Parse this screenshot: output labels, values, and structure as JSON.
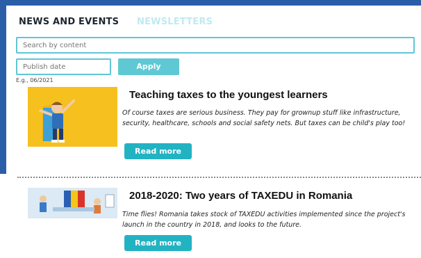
{
  "tabs": {
    "news": "NEWS AND EVENTS",
    "newsletters": "NEWSLETTERS"
  },
  "search": {
    "placeholder": "Search by content",
    "value": ""
  },
  "date_filter": {
    "placeholder": "Publish date",
    "value": "",
    "hint": "E.g., 06/2021"
  },
  "apply_label": "Apply",
  "articles": [
    {
      "title": "Teaching taxes to the youngest learners",
      "excerpt": "Of course taxes are serious business. They pay for grownup stuff like infrastructure, security, healthcare, schools and social safety nets. But taxes can be child's play too!",
      "button": "Read more"
    },
    {
      "title": "2018-2020: Two years of TAXEDU in Romania",
      "excerpt": "Time flies! Romania takes stock of TAXEDU activities implemented since the project's launch in the country in 2018, and looks to the future.",
      "button": "Read more"
    }
  ],
  "colors": {
    "frame": "#2a5fa8",
    "accent": "#5fc6d6",
    "button": "#22b3c3",
    "inactive_tab": "#bfeaf0"
  }
}
